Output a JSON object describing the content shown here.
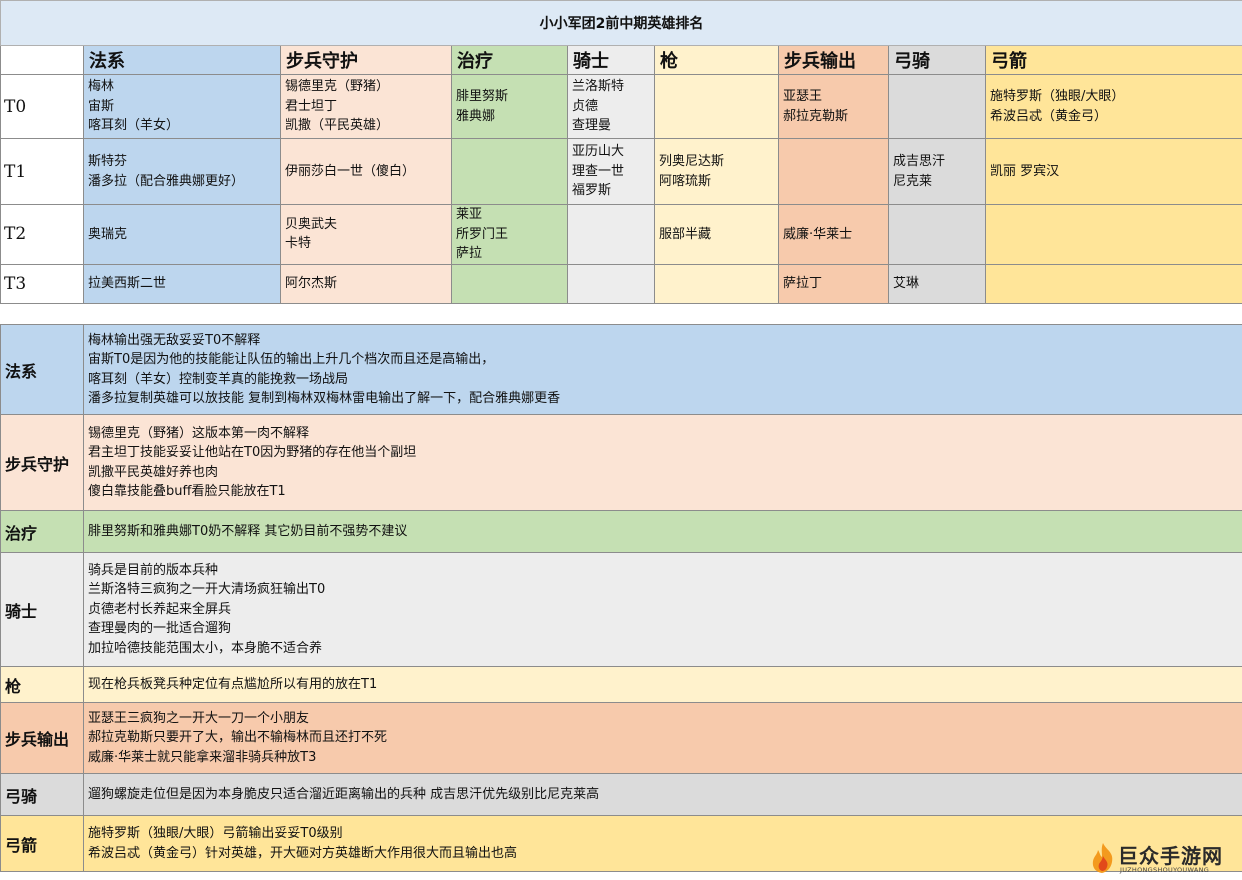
{
  "title": "小小军团2前中期英雄排名",
  "columns": [
    "法系",
    "步兵守护",
    "治疗",
    "骑士",
    "枪",
    "步兵输出",
    "弓骑",
    "弓箭"
  ],
  "tiers": [
    {
      "label": "T0",
      "cells": [
        [
          "梅林",
          "宙斯",
          "喀耳刻（羊女）"
        ],
        [
          "锡德里克（野猪）",
          "君士坦丁",
          "凯撒（平民英雄）"
        ],
        [
          "腓里努斯",
          "雅典娜"
        ],
        [
          "兰洛斯特",
          "贞德",
          "查理曼"
        ],
        [],
        [
          "亚瑟王",
          "郝拉克勒斯"
        ],
        [],
        [
          "施特罗斯（独眼/大眼）",
          "希波吕忒（黄金弓）"
        ]
      ]
    },
    {
      "label": "T1",
      "cells": [
        [
          "斯特芬",
          "潘多拉（配合雅典娜更好）"
        ],
        [
          "伊丽莎白一世（傻白）"
        ],
        [],
        [
          "亚历山大",
          "理查一世",
          "福罗斯"
        ],
        [
          "列奥尼达斯",
          "阿喀琉斯"
        ],
        [],
        [
          "成吉思汗",
          "尼克莱"
        ],
        [
          "凯丽 罗宾汉"
        ]
      ]
    },
    {
      "label": "T2",
      "cells": [
        [
          "奥瑞克"
        ],
        [
          "贝奥武夫",
          "卡特"
        ],
        [
          "莱亚",
          "所罗门王",
          "萨拉"
        ],
        [],
        [
          "服部半藏"
        ],
        [
          "威廉·华莱士"
        ],
        [],
        []
      ]
    },
    {
      "label": "T3",
      "cells": [
        [
          "拉美西斯二世"
        ],
        [
          "阿尔杰斯"
        ],
        [],
        [],
        [],
        [
          "萨拉丁"
        ],
        [
          "艾琳"
        ],
        []
      ]
    }
  ],
  "notes": [
    {
      "category": "法系",
      "lines": [
        "梅林输出强无敌妥妥T0不解释",
        "宙斯T0是因为他的技能能让队伍的输出上升几个档次而且还是高输出，",
        "喀耳刻（羊女）控制变羊真的能挽救一场战局",
        "潘多拉复制英雄可以放技能 复制到梅林双梅林雷电输出了解一下，配合雅典娜更香"
      ]
    },
    {
      "category": "步兵守护",
      "lines": [
        "锡德里克（野猪）这版本第一肉不解释",
        "君主坦丁技能妥妥让他站在T0因为野猪的存在他当个副坦",
        "凯撒平民英雄好养也肉",
        "傻白靠技能叠buff看脸只能放在T1"
      ]
    },
    {
      "category": "治疗",
      "lines": [
        "腓里努斯和雅典娜T0奶不解释 其它奶目前不强势不建议"
      ]
    },
    {
      "category": "骑士",
      "lines": [
        "骑兵是目前的版本兵种",
        "兰斯洛特三疯狗之一开大清场疯狂输出T0",
        "贞德老村长养起来全屏兵",
        "查理曼肉的一批适合遛狗",
        "加拉哈德技能范围太小，本身脆不适合养"
      ]
    },
    {
      "category": "枪",
      "lines": [
        "现在枪兵板凳兵种定位有点尴尬所以有用的放在T1"
      ]
    },
    {
      "category": "步兵输出",
      "lines": [
        "亚瑟王三疯狗之一开大一刀一个小朋友",
        "郝拉克勒斯只要开了大，输出不输梅林而且还打不死",
        "威廉·华莱士就只能拿来溜非骑兵种放T3"
      ]
    },
    {
      "category": "弓骑",
      "lines": [
        "遛狗螺旋走位但是因为本身脆皮只适合溜近距离输出的兵种 成吉思汗优先级别比尼克莱高"
      ]
    },
    {
      "category": "弓箭",
      "lines": [
        "施特罗斯（独眼/大眼）弓箭输出妥妥T0级别",
        "希波吕忒（黄金弓）针对英雄，开大砸对方英雄断大作用很大而且输出也高"
      ]
    }
  ],
  "watermark": {
    "name": "巨众手游网",
    "sub": "JUZHONGSHOUYOUWANG"
  }
}
